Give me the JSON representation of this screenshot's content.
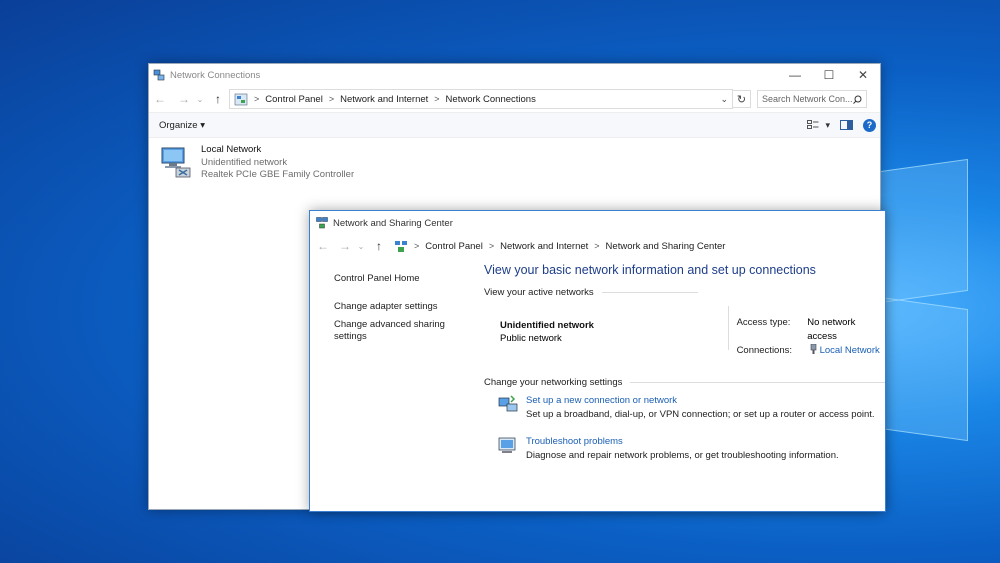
{
  "network_connections": {
    "title": "Network Connections",
    "caption": {
      "minimize": "—",
      "maximize": "☐",
      "close": "✕"
    },
    "nav": {
      "back": "←",
      "forward": "→",
      "dropdown": "⌄",
      "up": "↑",
      "refresh": "↻",
      "dropdown_arrow": "⌄"
    },
    "breadcrumb": [
      "Control Panel",
      "Network and Internet",
      "Network Connections"
    ],
    "separator": ">",
    "search_placeholder": "Search Network Con...",
    "toolbar": {
      "organize": "Organize",
      "organize_arrow": "▾",
      "view_arrow": "▾"
    },
    "item": {
      "name": "Local Network",
      "status": "Unidentified network",
      "adapter": "Realtek PCIe GBE Family Controller"
    }
  },
  "sharing_center": {
    "title": "Network and Sharing Center",
    "nav": {
      "back": "←",
      "forward": "→",
      "dropdown": "⌄",
      "up": "↑"
    },
    "breadcrumb": [
      "Control Panel",
      "Network and Internet",
      "Network and Sharing Center"
    ],
    "separator": ">",
    "sidebar": [
      "Control Panel Home",
      "Change adapter settings",
      "Change advanced sharing settings"
    ],
    "heading": "View your basic network information and set up connections",
    "active_networks_label": "View your active networks",
    "active_network": {
      "name": "Unidentified network",
      "type": "Public network",
      "access_type_label": "Access type:",
      "access_type_value": "No network access",
      "connections_label": "Connections:",
      "connections_value": "Local Network"
    },
    "change_settings_label": "Change your networking settings",
    "settings": [
      {
        "title": "Set up a new connection or network",
        "desc": "Set up a broadband, dial-up, or VPN connection; or set up a router or access point."
      },
      {
        "title": "Troubleshoot problems",
        "desc": "Diagnose and repair network problems, or get troubleshooting information."
      }
    ]
  }
}
